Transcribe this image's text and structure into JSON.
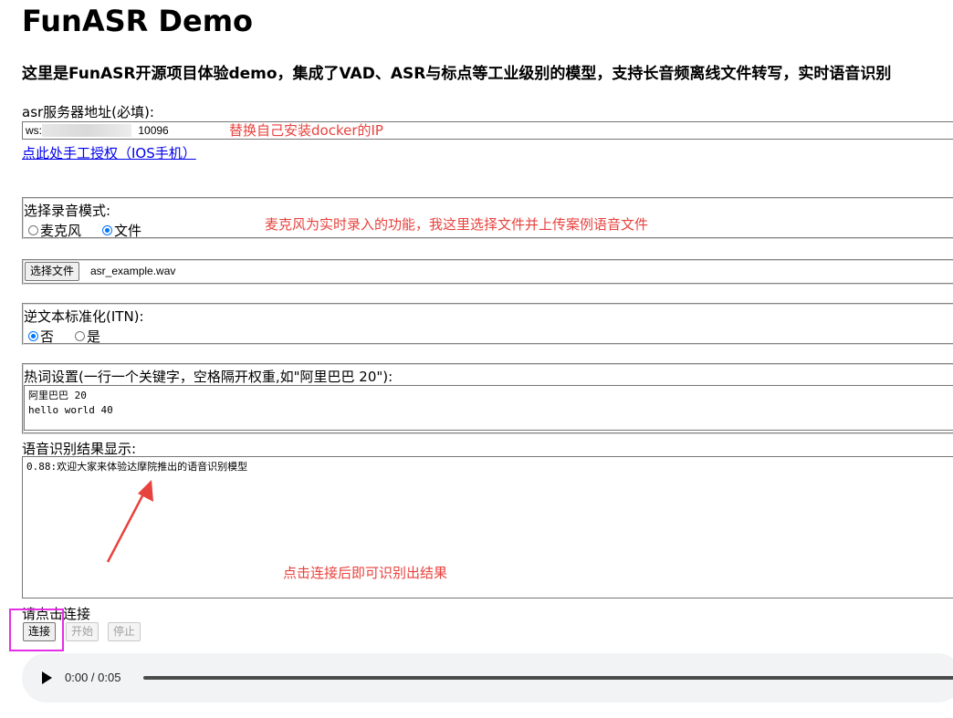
{
  "page": {
    "title": "FunASR Demo",
    "subtitle": "这里是FunASR开源项目体验demo，集成了VAD、ASR与标点等工业级别的模型，支持长音频离线文件转写，实时语音识别"
  },
  "server": {
    "label": "asr服务器地址(必填):",
    "prefix": "ws:/",
    "suffix": "10096",
    "annotation": "替换自己安装docker的IP",
    "auth_link": "点此处手工授权（IOS手机）"
  },
  "mode": {
    "label": "选择录音模式:",
    "options": [
      "麦克风",
      "文件"
    ],
    "selected": "文件",
    "annotation": "麦克风为实时录入的功能，我这里选择文件并上传案例语音文件"
  },
  "file": {
    "button_label": "选择文件",
    "file_name": "asr_example.wav"
  },
  "itn": {
    "label": "逆文本标准化(ITN):",
    "options": [
      "否",
      "是"
    ],
    "selected": "否"
  },
  "hotwords": {
    "label": "热词设置(一行一个关键字，空格隔开权重,如\"阿里巴巴 20\"):",
    "value": "阿里巴巴 20\nhello world 40"
  },
  "result": {
    "label": "语音识别结果显示:",
    "value": "0.88:欢迎大家来体验达摩院推出的语音识别模型",
    "annotation": "点击连接后即可识别出结果"
  },
  "controls": {
    "status": "请点击连接",
    "connect": "连接",
    "start": "开始",
    "stop": "停止"
  },
  "audio": {
    "time": "0:00 / 0:05"
  },
  "colors": {
    "annotation": "#e8423d",
    "highlight": "#e62ee6",
    "link": "#0000ee"
  }
}
